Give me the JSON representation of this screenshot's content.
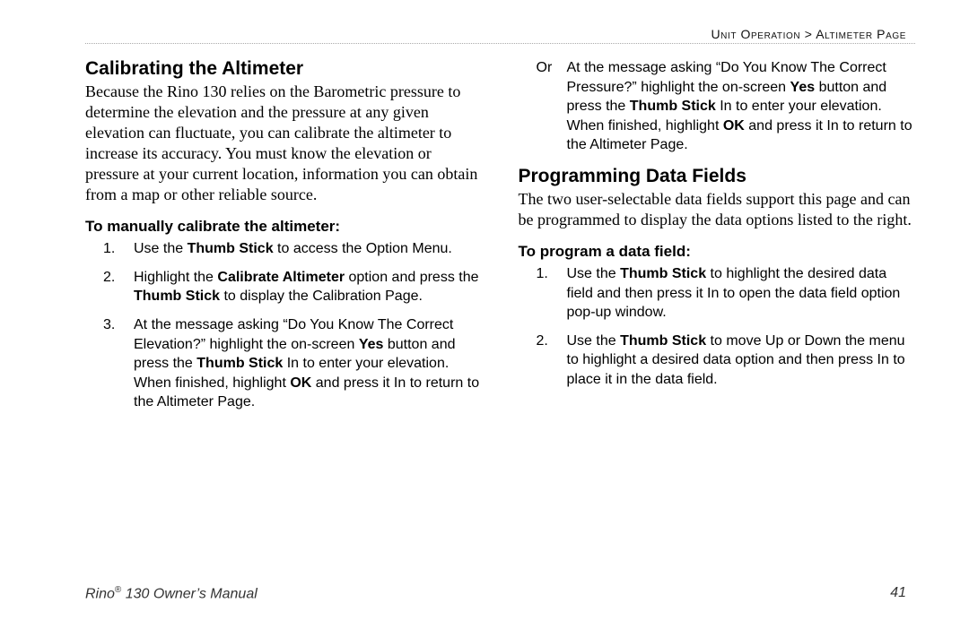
{
  "breadcrumb": {
    "section": "Unit Operation",
    "sep": " > ",
    "sub": "Altimeter Page"
  },
  "left": {
    "h2": "Calibrating the Altimeter",
    "intro": "Because the Rino 130 relies on the Barometric pressure to determine the elevation and the pressure at any given elevation can fluctuate, you can calibrate the altimeter to increase its accuracy. You must know the elevation or pressure at your current location, information you can obtain from a map or other reliable source.",
    "h3": "To manually calibrate the altimeter:",
    "steps": [
      {
        "n": "1.",
        "parts": [
          {
            "t": "Use the "
          },
          {
            "b": "Thumb Stick"
          },
          {
            "t": " to access the Option Menu."
          }
        ]
      },
      {
        "n": "2.",
        "parts": [
          {
            "t": "Highlight the "
          },
          {
            "b": "Calibrate Altimeter"
          },
          {
            "t": " option and press the "
          },
          {
            "b": "Thumb Stick"
          },
          {
            "t": " to display the Calibration Page."
          }
        ]
      },
      {
        "n": "3.",
        "parts": [
          {
            "t": "At the message asking “Do You Know The Correct Elevation?” highlight the on-screen "
          },
          {
            "b": "Yes"
          },
          {
            "t": " button and press the "
          },
          {
            "b": "Thumb Stick"
          },
          {
            "t": " In to enter your elevation. When finished, highlight "
          },
          {
            "b": "OK"
          },
          {
            "t": " and press it In to return to the Altimeter Page."
          }
        ]
      }
    ]
  },
  "right": {
    "orstep": {
      "pre": " Or",
      "parts": [
        {
          "t": "At the message asking “Do You Know The Correct Pressure?” highlight the on-screen "
        },
        {
          "b": "Yes"
        },
        {
          "t": " button and press the "
        },
        {
          "b": "Thumb Stick"
        },
        {
          "t": " In to enter your elevation. When finished, highlight "
        },
        {
          "b": "OK"
        },
        {
          "t": " and press it In to return to the Altimeter Page."
        }
      ]
    },
    "h2": "Programming Data Fields",
    "intro": "The two user-selectable data fields support this page and can be programmed to display the data options listed to the right.",
    "h3": "To program a data field:",
    "steps": [
      {
        "n": "1.",
        "parts": [
          {
            "t": "Use the "
          },
          {
            "b": "Thumb Stick"
          },
          {
            "t": " to highlight the desired data field and then press it In to open the data field option pop-up window."
          }
        ]
      },
      {
        "n": "2.",
        "parts": [
          {
            "t": "Use the "
          },
          {
            "b": "Thumb Stick"
          },
          {
            "t": " to move Up or Down the menu to highlight a desired data option and then press In to place it in the data field."
          }
        ]
      }
    ]
  },
  "footer": {
    "product_a": "Rino",
    "reg": "®",
    "product_b": " 130 Owner’s Manual",
    "page": "41"
  }
}
